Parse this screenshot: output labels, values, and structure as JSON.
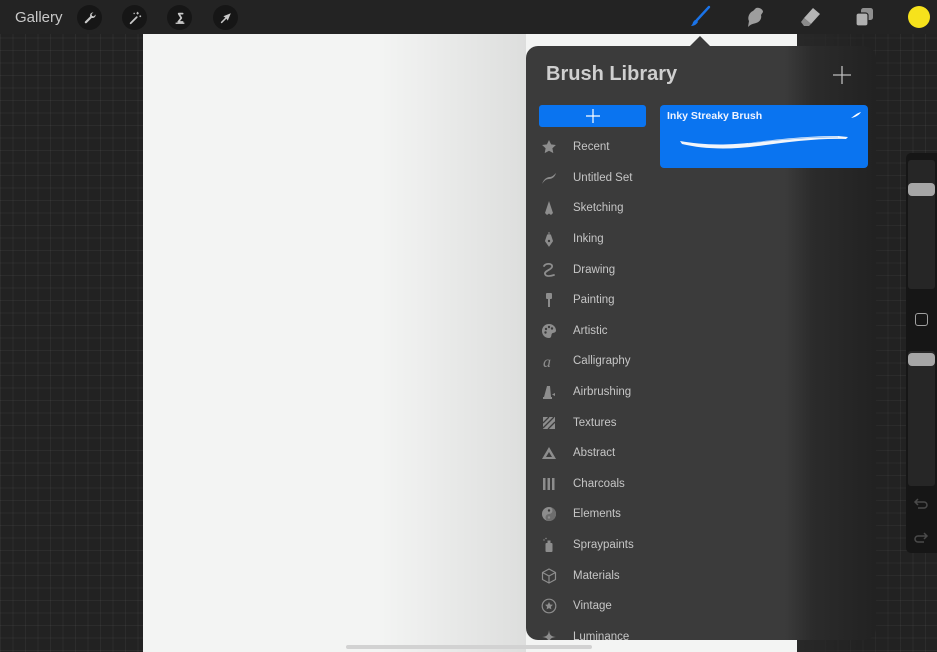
{
  "topbar": {
    "gallery_label": "Gallery",
    "left_tools": [
      {
        "name": "actions",
        "icon": "wrench-icon"
      },
      {
        "name": "adjustments",
        "icon": "magic-wand-icon"
      },
      {
        "name": "selection",
        "icon": "selection-s-icon"
      },
      {
        "name": "transform",
        "icon": "arrow-cursor-icon"
      }
    ],
    "right_tools": [
      {
        "name": "brush",
        "icon": "brush-icon",
        "active": true
      },
      {
        "name": "smudge",
        "icon": "smudge-icon",
        "active": false
      },
      {
        "name": "eraser",
        "icon": "eraser-icon",
        "active": false
      },
      {
        "name": "layers",
        "icon": "layers-icon",
        "active": false
      }
    ],
    "current_color": "#f6e21c",
    "accent_color": "#1a73e8"
  },
  "brush_library": {
    "title": "Brush Library",
    "add_brush_icon": "plus-icon",
    "add_set_icon": "plus-icon",
    "sets": [
      {
        "label": "Recent",
        "icon": "star-icon"
      },
      {
        "label": "Untitled Set",
        "icon": "stroke-icon"
      },
      {
        "label": "Sketching",
        "icon": "pencil-tip-icon"
      },
      {
        "label": "Inking",
        "icon": "pen-nib-icon"
      },
      {
        "label": "Drawing",
        "icon": "squiggle-icon"
      },
      {
        "label": "Painting",
        "icon": "paintbrush-icon"
      },
      {
        "label": "Artistic",
        "icon": "palette-icon"
      },
      {
        "label": "Calligraphy",
        "icon": "script-a-icon"
      },
      {
        "label": "Airbrushing",
        "icon": "airbrush-icon"
      },
      {
        "label": "Textures",
        "icon": "hatch-square-icon"
      },
      {
        "label": "Abstract",
        "icon": "triangle-icon"
      },
      {
        "label": "Charcoals",
        "icon": "charcoal-sticks-icon"
      },
      {
        "label": "Elements",
        "icon": "yin-yang-icon"
      },
      {
        "label": "Spraypaints",
        "icon": "spray-can-icon"
      },
      {
        "label": "Materials",
        "icon": "cube-icon"
      },
      {
        "label": "Vintage",
        "icon": "star-circle-icon"
      },
      {
        "label": "Luminance",
        "icon": "sparkle-icon"
      }
    ],
    "brushes": [
      {
        "name": "Inky Streaky Brush",
        "selected": true
      }
    ],
    "selection_color": "#0a74f0"
  },
  "sidebar": {
    "size_slider_value": 0.8,
    "opacity_slider_value": 0.98,
    "modify_button_icon": "square-icon",
    "undo_icon": "undo-icon",
    "redo_icon": "redo-icon"
  }
}
